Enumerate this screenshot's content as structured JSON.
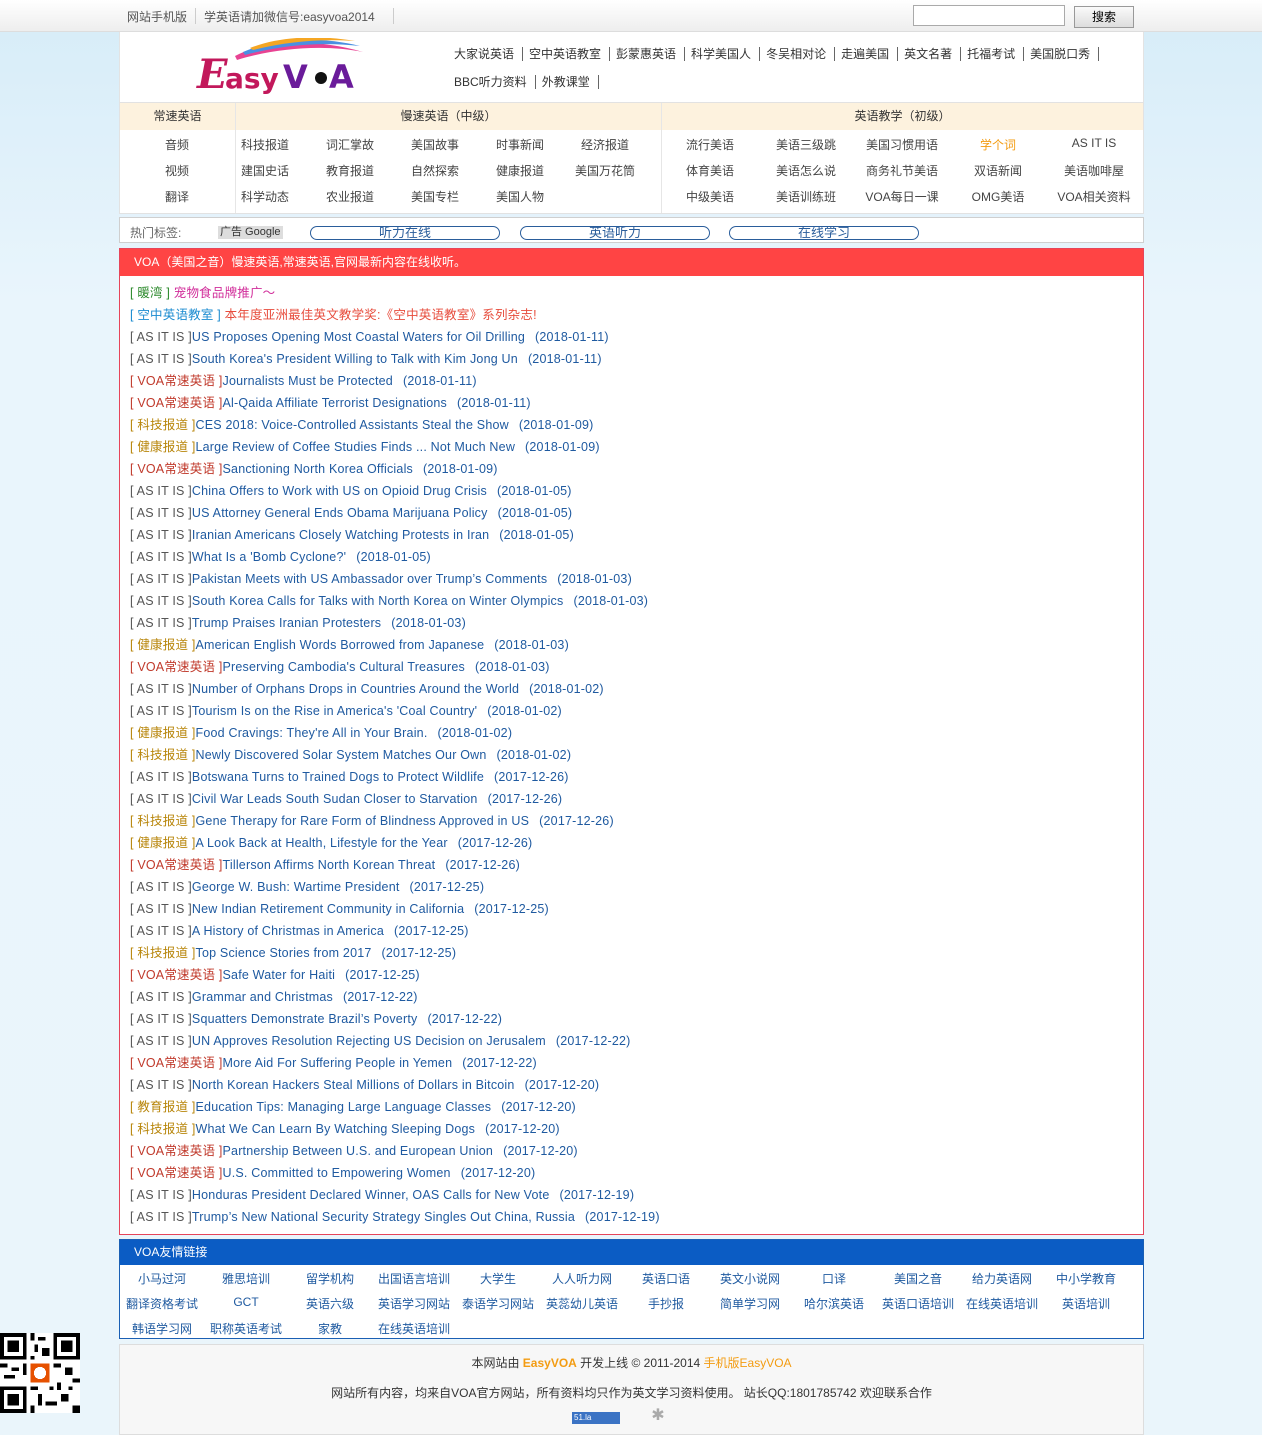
{
  "topbar": {
    "mobile_link": "网站手机版",
    "wechat_text": "学英语请加微信号:easyvoa2014",
    "search_placeholder": "",
    "search_button": "搜索"
  },
  "header": {
    "logo_text": "EasyVOA",
    "nav": [
      "大家说英语",
      "空中英语教室",
      "彭蒙惠英语",
      "科学美国人",
      "冬吴相对论",
      "走遍美国",
      "英文名著",
      "托福考试",
      "美国脱口秀",
      "BBC听力资料",
      "外教课堂"
    ]
  },
  "categories": {
    "col1": {
      "head": "常速英语",
      "items": [
        "音频",
        "视频",
        "翻译"
      ]
    },
    "col2": {
      "head": "慢速英语（中级）",
      "items": [
        "科技报道",
        "词汇掌故",
        "美国故事",
        "时事新闻",
        "经济报道",
        "建国史话",
        "教育报道",
        "自然探索",
        "健康报道",
        "美国万花筒",
        "科学动态",
        "农业报道",
        "美国专栏",
        "美国人物"
      ]
    },
    "col3": {
      "head": "英语教学（初级）",
      "items": [
        "流行美语",
        "美语三级跳",
        "美国习惯用语",
        "学个词",
        "AS IT IS",
        "体育美语",
        "美语怎么说",
        "商务礼节美语",
        "双语新闻",
        "美语咖啡屋",
        "中级美语",
        "美语训练班",
        "VOA每日一课",
        "OMG美语",
        "VOA相关资料"
      ]
    }
  },
  "hot": {
    "label": "热门标签:",
    "ad": "广告 Google",
    "pills": [
      "听力在线",
      "英语听力",
      "在线学习"
    ]
  },
  "main": {
    "heading": "VOA（美国之音）慢速英语,常速英语,官网最新内容在线收听。",
    "promos": [
      {
        "tag": "[ 暖湾 ]",
        "text": "宠物食品牌推广～"
      },
      {
        "tag": "[ 空中英语教室 ]",
        "text": "本年度亚洲最佳英文教学奖:《空中英语教室》系列杂志!"
      }
    ],
    "items": [
      {
        "cat": "[ AS IT IS ]",
        "title": "US Proposes Opening Most Coastal Waters for Oil Drilling",
        "date": "(2018-01-11)",
        "color": "grey"
      },
      {
        "cat": "[ AS IT IS ]",
        "title": "South Korea's President Willing to Talk with Kim Jong Un",
        "date": "(2018-01-11)",
        "color": "grey"
      },
      {
        "cat": "[ VOA常速英语 ]",
        "title": "Journalists Must be Protected",
        "date": "(2018-01-11)",
        "color": "red"
      },
      {
        "cat": "[ VOA常速英语 ]",
        "title": "Al-Qaida Affiliate Terrorist Designations",
        "date": "(2018-01-11)",
        "color": "red"
      },
      {
        "cat": "[ 科技报道 ]",
        "title": "CES 2018: Voice-Controlled Assistants Steal the Show",
        "date": "(2018-01-09)",
        "color": "yellow"
      },
      {
        "cat": "[ 健康报道 ]",
        "title": "Large Review of Coffee Studies Finds ... Not Much New",
        "date": "(2018-01-09)",
        "color": "yellow"
      },
      {
        "cat": "[ VOA常速英语 ]",
        "title": "Sanctioning North Korea Officials",
        "date": "(2018-01-09)",
        "color": "red"
      },
      {
        "cat": "[ AS IT IS ]",
        "title": "China Offers to Work with US on Opioid Drug Crisis",
        "date": "(2018-01-05)",
        "color": "grey"
      },
      {
        "cat": "[ AS IT IS ]",
        "title": "US Attorney General Ends Obama Marijuana Policy",
        "date": "(2018-01-05)",
        "color": "grey"
      },
      {
        "cat": "[ AS IT IS ]",
        "title": "Iranian Americans Closely Watching Protests in Iran",
        "date": "(2018-01-05)",
        "color": "grey"
      },
      {
        "cat": "[ AS IT IS ]",
        "title": "What Is a 'Bomb Cyclone?'",
        "date": "(2018-01-05)",
        "color": "grey"
      },
      {
        "cat": "[ AS IT IS ]",
        "title": "Pakistan Meets with US Ambassador over Trump’s Comments",
        "date": "(2018-01-03)",
        "color": "grey"
      },
      {
        "cat": "[ AS IT IS ]",
        "title": "South Korea Calls for Talks with North Korea on Winter Olympics",
        "date": "(2018-01-03)",
        "color": "grey"
      },
      {
        "cat": "[ AS IT IS ]",
        "title": "Trump Praises Iranian Protesters",
        "date": "(2018-01-03)",
        "color": "grey"
      },
      {
        "cat": "[ 健康报道 ]",
        "title": "American English Words Borrowed from Japanese",
        "date": "(2018-01-03)",
        "color": "yellow"
      },
      {
        "cat": "[ VOA常速英语 ]",
        "title": "Preserving Cambodia's Cultural Treasures",
        "date": "(2018-01-03)",
        "color": "red"
      },
      {
        "cat": "[ AS IT IS ]",
        "title": "Number of Orphans Drops in Countries Around the World",
        "date": "(2018-01-02)",
        "color": "grey"
      },
      {
        "cat": "[ AS IT IS ]",
        "title": "Tourism Is on the Rise in America's 'Coal Country'",
        "date": "(2018-01-02)",
        "color": "grey"
      },
      {
        "cat": "[ 健康报道 ]",
        "title": "Food Cravings: They're All in Your Brain.",
        "date": "(2018-01-02)",
        "color": "yellow"
      },
      {
        "cat": "[ 科技报道 ]",
        "title": "Newly Discovered Solar System Matches Our Own",
        "date": "(2018-01-02)",
        "color": "yellow"
      },
      {
        "cat": "[ AS IT IS ]",
        "title": "Botswana Turns to Trained Dogs to Protect Wildlife",
        "date": "(2017-12-26)",
        "color": "grey"
      },
      {
        "cat": "[ AS IT IS ]",
        "title": "Civil War Leads South Sudan Closer to Starvation",
        "date": "(2017-12-26)",
        "color": "grey"
      },
      {
        "cat": "[ 科技报道 ]",
        "title": "Gene Therapy for Rare Form of Blindness Approved in US",
        "date": "(2017-12-26)",
        "color": "yellow"
      },
      {
        "cat": "[ 健康报道 ]",
        "title": "A Look Back at Health, Lifestyle for the Year",
        "date": "(2017-12-26)",
        "color": "yellow"
      },
      {
        "cat": "[ VOA常速英语 ]",
        "title": "Tillerson Affirms North Korean Threat",
        "date": "(2017-12-26)",
        "color": "red"
      },
      {
        "cat": "[ AS IT IS ]",
        "title": "George W. Bush: Wartime President",
        "date": "(2017-12-25)",
        "color": "grey"
      },
      {
        "cat": "[ AS IT IS ]",
        "title": "New Indian Retirement Community in California",
        "date": "(2017-12-25)",
        "color": "grey"
      },
      {
        "cat": "[ AS IT IS ]",
        "title": "A History of Christmas in America",
        "date": "(2017-12-25)",
        "color": "grey"
      },
      {
        "cat": "[ 科技报道 ]",
        "title": "Top Science Stories from 2017",
        "date": "(2017-12-25)",
        "color": "yellow"
      },
      {
        "cat": "[ VOA常速英语 ]",
        "title": "Safe Water for Haiti",
        "date": "(2017-12-25)",
        "color": "red"
      },
      {
        "cat": "[ AS IT IS ]",
        "title": "Grammar and Christmas",
        "date": "(2017-12-22)",
        "color": "grey"
      },
      {
        "cat": "[ AS IT IS ]",
        "title": "Squatters Demonstrate Brazil’s Poverty",
        "date": "(2017-12-22)",
        "color": "grey"
      },
      {
        "cat": "[ AS IT IS ]",
        "title": "UN Approves Resolution Rejecting US Decision on Jerusalem",
        "date": "(2017-12-22)",
        "color": "grey"
      },
      {
        "cat": "[ VOA常速英语 ]",
        "title": "More Aid For Suffering People in Yemen",
        "date": "(2017-12-22)",
        "color": "red"
      },
      {
        "cat": "[ AS IT IS ]",
        "title": "North Korean Hackers Steal Millions of Dollars in Bitcoin",
        "date": "(2017-12-20)",
        "color": "grey"
      },
      {
        "cat": "[ 教育报道 ]",
        "title": "Education Tips: Managing Large Language Classes",
        "date": "(2017-12-20)",
        "color": "yellow"
      },
      {
        "cat": "[ 科技报道 ]",
        "title": "What We Can Learn By Watching Sleeping Dogs",
        "date": "(2017-12-20)",
        "color": "yellow"
      },
      {
        "cat": "[ VOA常速英语 ]",
        "title": "Partnership Between U.S. and European Union",
        "date": "(2017-12-20)",
        "color": "red"
      },
      {
        "cat": "[ VOA常速英语 ]",
        "title": "U.S. Committed to Empowering Women",
        "date": "(2017-12-20)",
        "color": "red"
      },
      {
        "cat": "[ AS IT IS ]",
        "title": "Honduras President Declared Winner, OAS Calls for New Vote",
        "date": "(2017-12-19)",
        "color": "grey"
      },
      {
        "cat": "[ AS IT IS ]",
        "title": "Trump’s New National Security Strategy Singles Out China, Russia",
        "date": "(2017-12-19)",
        "color": "grey"
      }
    ]
  },
  "friend_links": {
    "heading": "VOA友情链接",
    "rows": [
      [
        "小马过河",
        "雅思培训",
        "留学机构",
        "出国语言培训",
        "大学生",
        "人人听力网",
        "英语口语",
        "英文小说网",
        "口译",
        "美国之音",
        "给力英语网",
        "中小学教育"
      ],
      [
        "翻译资格考试",
        "GCT",
        "英语六级",
        "英语学习网站",
        "泰语学习网站",
        "英蕊幼儿英语",
        "手抄报",
        "简单学习网",
        "哈尔滨英语",
        "英语口语培训",
        "在线英语培训",
        "英语培训"
      ],
      [
        "韩语学习网",
        "职称英语考试",
        "家教",
        "在线英语培训"
      ]
    ]
  },
  "footer": {
    "line1_prefix": "本网站由",
    "brand": "EasyVOA",
    "line1_mid": "开发上线 © 2011-2014",
    "mobile": "手机版EasyVOA",
    "line2": "网站所有内容，均来自VOA官方网站，所有资料均只作为英文学习资料使用。 站长QQ:1801785742 欢迎联系合作",
    "counter": "51.la"
  }
}
